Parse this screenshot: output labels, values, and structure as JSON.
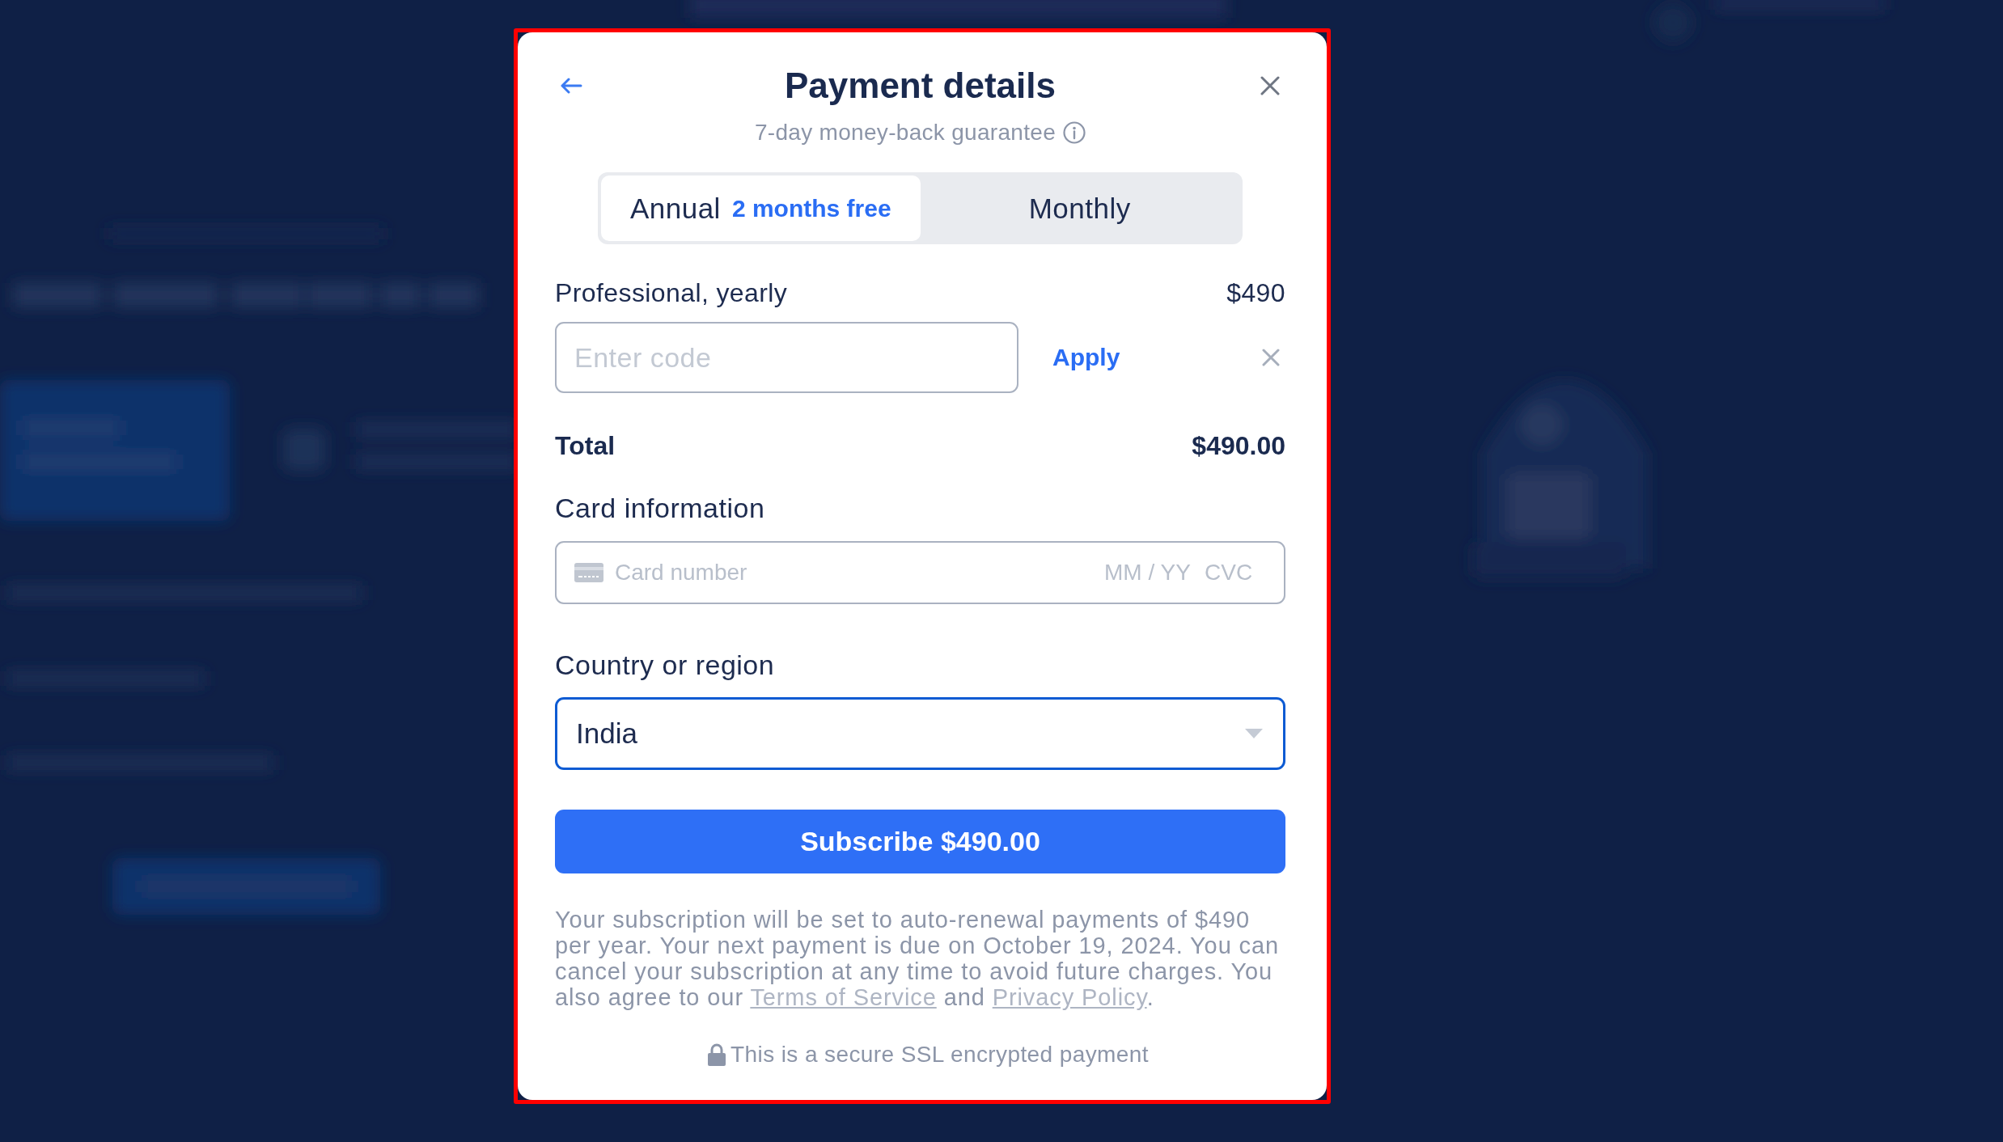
{
  "dialog": {
    "title": "Payment details",
    "subtitle": "7-day money-back guarantee"
  },
  "billing_periods": [
    {
      "label": "Annual",
      "badge": "2 months free",
      "selected": true
    },
    {
      "label": "Monthly",
      "selected": false
    }
  ],
  "plan": {
    "name": "Professional, yearly",
    "price": "$490"
  },
  "promo_code": {
    "placeholder": "Enter code",
    "apply_label": "Apply"
  },
  "total": {
    "label": "Total",
    "amount": "$490.00"
  },
  "card": {
    "label": "Card information",
    "number_placeholder": "Card number",
    "expiry_placeholder": "MM / YY",
    "cvc_placeholder": "CVC"
  },
  "country": {
    "label": "Country or region",
    "value": "India",
    "focused": true
  },
  "subscribe_button": "Subscribe $490.00",
  "disclaimer": [
    {
      "kind": "text",
      "text": "Your subscription will be set to auto-renewal payments of $490 per year. Your next payment is due on October 19, 2024. You can cancel your subscription at any time to avoid future charges. You also agree to our "
    },
    {
      "kind": "link",
      "text": "Terms of Service"
    },
    {
      "kind": "text",
      "text": " and "
    },
    {
      "kind": "link",
      "text": "Privacy Policy"
    },
    {
      "kind": "text",
      "text": "."
    }
  ],
  "secure_note": "This is a secure SSL encrypted payment"
}
